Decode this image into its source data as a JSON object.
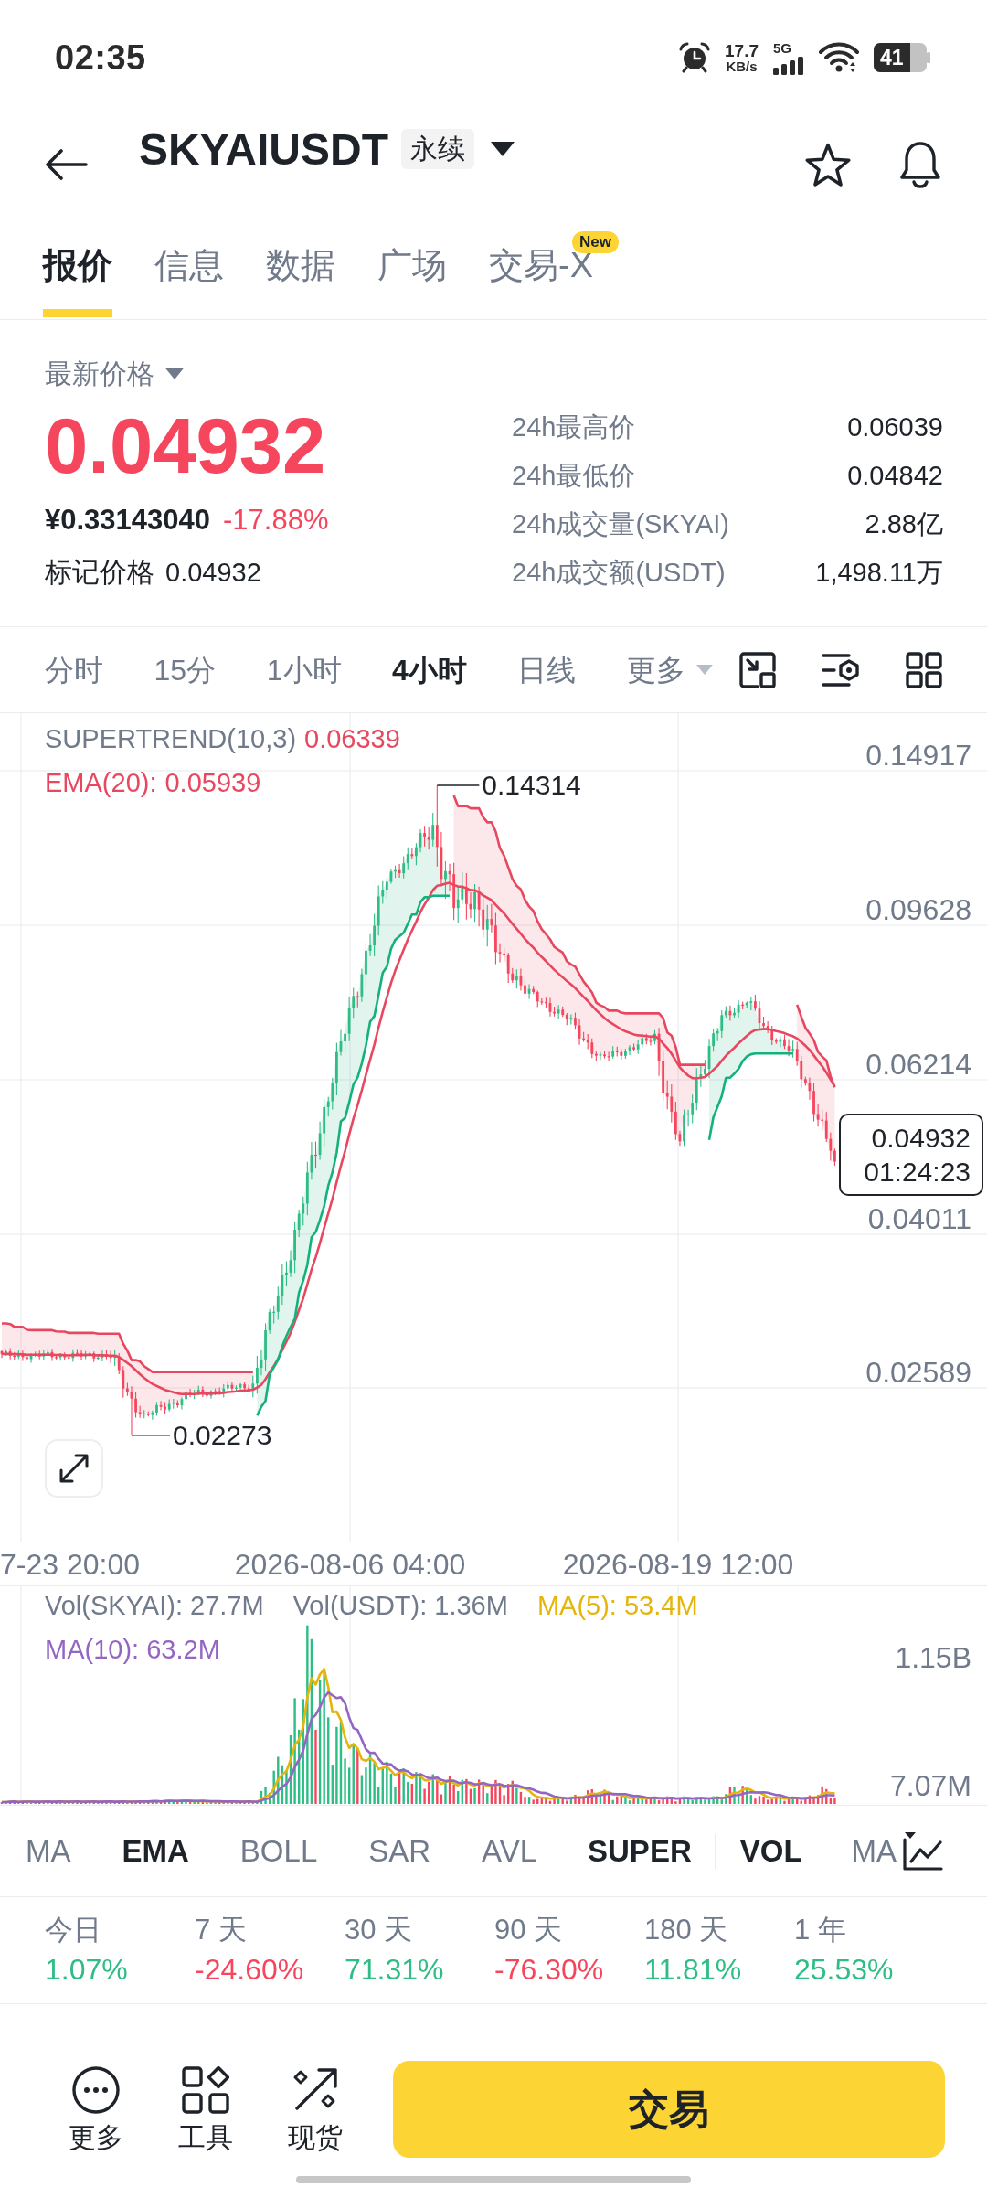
{
  "status_bar": {
    "time": "02:35",
    "net_speed": "17.7",
    "net_speed_unit": "KB/s",
    "network_type": "5G",
    "battery": "41"
  },
  "header": {
    "symbol": "SKYAIUSDT",
    "contract_tag": "永续"
  },
  "tabs": [
    {
      "label": "报价",
      "selected": true
    },
    {
      "label": "信息",
      "selected": false
    },
    {
      "label": "数据",
      "selected": false
    },
    {
      "label": "广场",
      "selected": false
    },
    {
      "label": "交易-X",
      "selected": false,
      "badge": "New"
    }
  ],
  "price_panel": {
    "selector_label": "最新价格",
    "last_price": "0.04932",
    "rising": false,
    "cny_price": "¥0.33143040",
    "change_pct": "-17.88%",
    "mark_label": "标记价格",
    "mark_price": "0.04932",
    "stats": [
      {
        "label": "24h最高价",
        "value": "0.06039"
      },
      {
        "label": "24h最低价",
        "value": "0.04842"
      },
      {
        "label": "24h成交量(SKYAI)",
        "value": "2.88亿"
      },
      {
        "label": "24h成交额(USDT)",
        "value": "1,498.11万"
      }
    ]
  },
  "intervals": [
    {
      "label": "分时",
      "selected": false,
      "kind": "interval"
    },
    {
      "label": "15分",
      "selected": false,
      "kind": "interval"
    },
    {
      "label": "1小时",
      "selected": false,
      "kind": "interval"
    },
    {
      "label": "4小时",
      "selected": true,
      "kind": "interval"
    },
    {
      "label": "日线",
      "selected": false,
      "kind": "interval"
    },
    {
      "label": "更多",
      "selected": false,
      "kind": "menu"
    }
  ],
  "price_chart": {
    "legend": [
      {
        "label": "SUPERTREND(10,3)",
        "value": "0.06339",
        "muted_label": true,
        "color": "#e8485f"
      },
      {
        "label": "EMA(20):",
        "value": "0.05939",
        "muted_label": false,
        "color": "#e8485f"
      }
    ],
    "price_axis": [
      "0.14917",
      "0.09628",
      "0.06214",
      "0.04011",
      "0.02589"
    ],
    "high_marker": "0.14314",
    "low_marker": "0.02273",
    "last_price_tag": {
      "price": "0.04932",
      "countdown": "01:24:23"
    },
    "time_axis": [
      "7-23 20:00",
      "2026-08-06 04:00",
      "2026-08-19 12:00"
    ]
  },
  "volume_chart": {
    "legend": [
      {
        "label": "Vol(SKYAI):",
        "value": "27.7M",
        "color": "#707a8a"
      },
      {
        "label": "Vol(USDT):",
        "value": "1.36M",
        "color": "#707a8a"
      },
      {
        "label": "MA(5):",
        "value": "53.4M",
        "color": "#e5b50c"
      },
      {
        "label": "MA(10):",
        "value": "63.2M",
        "color": "#9466c4"
      }
    ],
    "axis": [
      "1.15B",
      "7.07M"
    ]
  },
  "indicators": {
    "main": [
      {
        "label": "MA",
        "selected": false
      },
      {
        "label": "EMA",
        "selected": true
      },
      {
        "label": "BOLL",
        "selected": false
      },
      {
        "label": "SAR",
        "selected": false
      },
      {
        "label": "AVL",
        "selected": false
      },
      {
        "label": "SUPER",
        "selected": true
      }
    ],
    "sub": [
      {
        "label": "VOL",
        "selected": true
      },
      {
        "label": "MA",
        "selected": false
      }
    ]
  },
  "returns": [
    {
      "period": "今日",
      "value": "1.07%",
      "rising": true
    },
    {
      "period": "7 天",
      "value": "-24.60%",
      "rising": false
    },
    {
      "period": "30 天",
      "value": "71.31%",
      "rising": true
    },
    {
      "period": "90 天",
      "value": "-76.30%",
      "rising": false
    },
    {
      "period": "180 天",
      "value": "11.81%",
      "rising": true
    },
    {
      "period": "1 年",
      "value": "25.53%",
      "rising": true
    }
  ],
  "bottom_bar": {
    "actions": [
      {
        "label": "更多"
      },
      {
        "label": "工具"
      },
      {
        "label": "现货"
      }
    ],
    "trade_button": "交易"
  }
}
